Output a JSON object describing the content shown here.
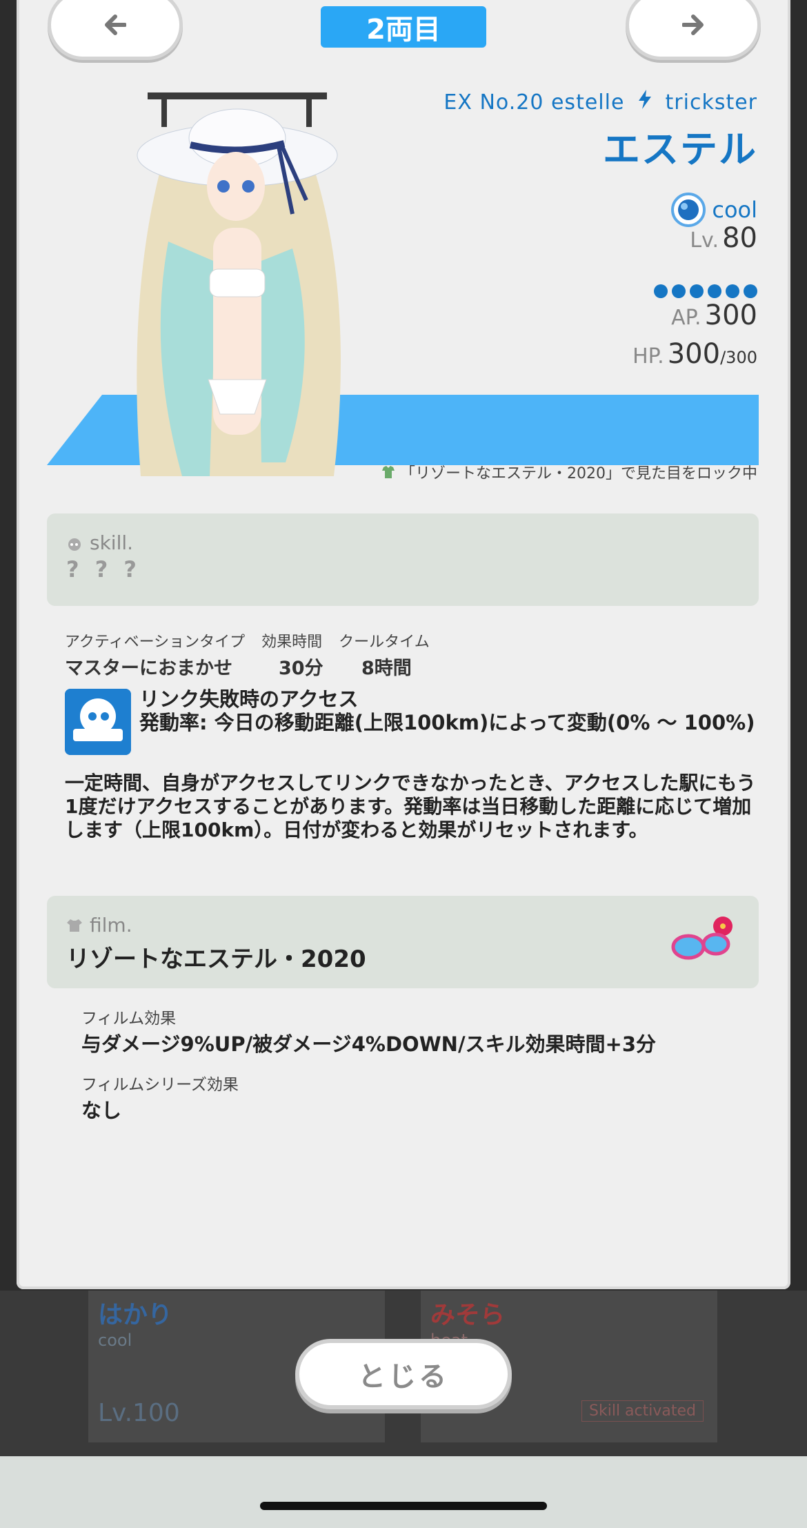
{
  "header": {
    "car_label": "2両目"
  },
  "character": {
    "id_line": "EX No.20 estelle",
    "class": "trickster",
    "name": "エステル",
    "attribute": "cool",
    "level_label": "Lv.",
    "level": "80",
    "ap_label": "AP.",
    "ap": "300",
    "hp_label": "HP.",
    "hp": "300",
    "hp_max": "/300",
    "rank_dots": 6,
    "lock_note": "「リゾートなエステル・2020」で見た目をロック中"
  },
  "skill": {
    "section_label": "skill.",
    "name": "? ? ?",
    "headers": [
      "アクティベーションタイプ",
      "効果時間",
      "クールタイム"
    ],
    "values": [
      "マスターにおまかせ",
      "30分",
      "8時間"
    ],
    "title_line1": "リンク失敗時のアクセス",
    "title_line2": "発動率: 今日の移動距離(上限100km)によって変動(0% 〜 100%)",
    "description": "一定時間、自身がアクセスしてリンクできなかったとき、アクセスした駅にもう1度だけアクセスすることがあります。発動率は当日移動した距離に応じて増加します（上限100km）。日付が変わると効果がリセットされます。"
  },
  "film": {
    "section_label": "film.",
    "name": "リゾートなエステル・2020",
    "effect_label": "フィルム効果",
    "effect": "与ダメージ9%UP/被ダメージ4%DOWN/スキル効果時間+3分",
    "series_label": "フィルムシリーズ効果",
    "series": "なし"
  },
  "background": {
    "left_name": "はかり",
    "left_attr": "cool",
    "left_level": "Lv.100",
    "right_name": "みそら",
    "right_attr": "heat",
    "right_badge": "Skill activated"
  },
  "close_label": "とじる",
  "colors": {
    "accent": "#2aa7f5",
    "text_blue": "#1576c4",
    "panel": "#dce2dc"
  },
  "icons": [
    "arrow-left-icon",
    "arrow-right-icon",
    "lightning-icon",
    "cool-attribute-icon",
    "film-lock-icon",
    "skill-icon",
    "shirt-icon",
    "sunglasses-icon"
  ]
}
